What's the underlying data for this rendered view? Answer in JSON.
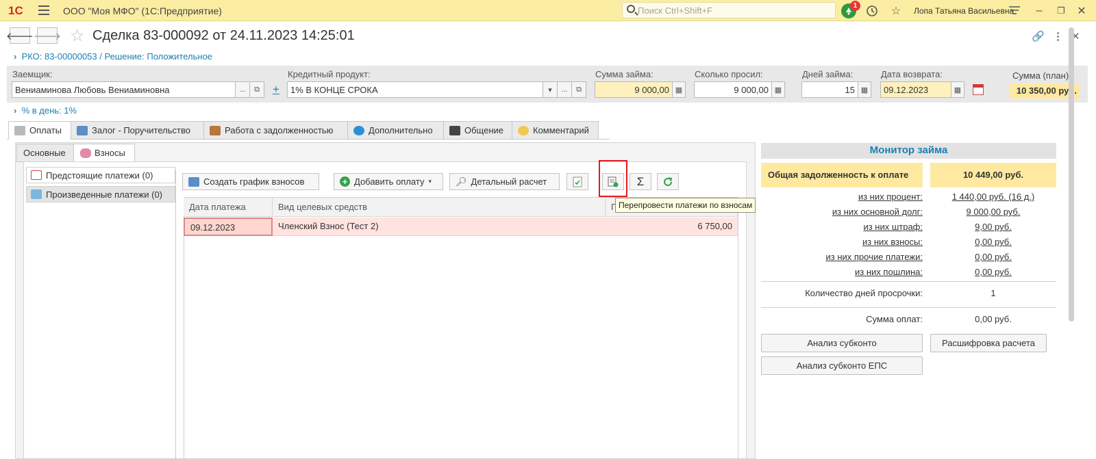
{
  "app": {
    "logo": "1С",
    "title": "ООО \"Моя МФО\"  (1С:Предприятие)",
    "search_placeholder": "Поиск Ctrl+Shift+F",
    "notification_count": "1",
    "user": "Лопа Татьяна Васильевна"
  },
  "document": {
    "title": "Сделка 83-000092 от 24.11.2023 14:25:01",
    "breadcrumb": "РКО: 83-00000053 / Решение: Положительное",
    "percent_link": "% в день: 1%"
  },
  "fields": {
    "borrower_label": "Заемщик:",
    "borrower_value": "Вениаминова Любовь Вениаминовна",
    "product_label": "Кредитный продукт:",
    "product_value": "1% В КОНЦЕ СРОКА",
    "loan_sum_label": "Сумма займа:",
    "loan_sum_value": "9 000,00",
    "requested_label": "Сколько просил:",
    "requested_value": "9 000,00",
    "days_label": "Дней займа:",
    "days_value": "15",
    "return_date_label": "Дата возврата:",
    "return_date_value": "09.12.2023",
    "plan_sum_label": "Сумма (план):",
    "plan_sum_value": "10 350,00 руб."
  },
  "tabs": [
    "Оплаты",
    "Залог - Поручительство",
    "Работа с задолженностью",
    "Дополнительно",
    "Общение",
    "Комментарий"
  ],
  "subtabs": [
    "Основные",
    "Взносы"
  ],
  "left_menu": [
    "Предстоящие платежи (0)",
    "Произведенные платежи (0)"
  ],
  "toolbar": {
    "create_schedule": "Создать график взносов",
    "add_payment": "Добавить оплату",
    "detailed_calc": "Детальный расчет",
    "tooltip": "Перепровести платежи по взносам",
    "sum_glyph": "Σ"
  },
  "grid": {
    "columns": [
      "Дата платежа",
      "Вид целевых средств",
      "П"
    ],
    "rows": [
      {
        "date": "09.12.2023",
        "kind": "Членский Взнос (Тест 2)",
        "amount": "6 750,00"
      }
    ]
  },
  "monitor": {
    "title": "Монитор займа",
    "total_label": "Общая задолженность к оплате",
    "total_value": "10 449,00 руб.",
    "rows": [
      {
        "label": "из них процент:",
        "value": "1 440,00 руб. (16 д.)"
      },
      {
        "label": "из них основной долг:",
        "value": "9 000,00 руб."
      },
      {
        "label": "из них штраф:",
        "value": "9,00 руб."
      },
      {
        "label": "из них взносы:",
        "value": "0,00 руб."
      },
      {
        "label": "из них прочие платежи:",
        "value": "0,00 руб."
      },
      {
        "label": "из них пошлина:",
        "value": "0,00 руб."
      }
    ],
    "overdue_label": "Количество дней просрочки:",
    "overdue_value": "1",
    "payments_label": "Сумма оплат:",
    "payments_value": "0,00 руб.",
    "btn_analysis": "Анализ субконто",
    "btn_breakdown": "Расшифровка расчета",
    "btn_analysis_eps": "Анализ субконто ЕПС"
  },
  "colors": {
    "topbar": "#FBEDA2",
    "link": "#1B7FB3",
    "highlight_row": "#FFE3E0",
    "yellow_field": "#FFF1BD",
    "callout": "#E21B1B"
  }
}
